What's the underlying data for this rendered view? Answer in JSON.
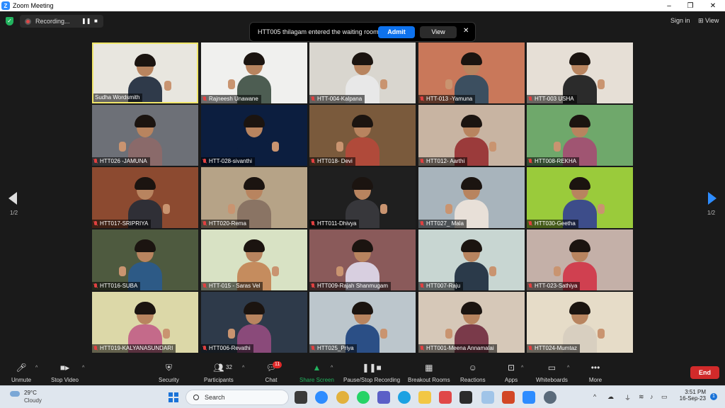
{
  "window": {
    "title": "Zoom Meeting",
    "controls": [
      "–",
      "❐",
      "✕"
    ]
  },
  "top": {
    "recording_label": "Recording...",
    "sign_in": "Sign in",
    "view": "View"
  },
  "waiting_room": {
    "message": "HTT005 thilagam entered the waiting room",
    "admit": "Admit",
    "view": "View",
    "close": "✕"
  },
  "pager": {
    "left": "1/2",
    "right": "1/2"
  },
  "participants": [
    {
      "name": "Sudha Wordsmith",
      "muted": false,
      "active": true,
      "bg": "#e8e6df",
      "shirt": "#2f3a4a"
    },
    {
      "name": "Rajneesh Unawane",
      "muted": true,
      "bg": "#f0f0ee",
      "shirt": "#4d5d52"
    },
    {
      "name": "HTT-004-Kalpana",
      "muted": true,
      "bg": "#d9d6cf",
      "shirt": "#e8e8e8"
    },
    {
      "name": "HTT-013 -Yamuna",
      "muted": true,
      "bg": "#c9785a",
      "shirt": "#3c4f60"
    },
    {
      "name": "HTT-003 USHA",
      "muted": true,
      "bg": "#e6dfd6",
      "shirt": "#2b2b2b"
    },
    {
      "name": "HTT026 -JAMUNA",
      "muted": true,
      "bg": "#6d7077",
      "shirt": "#8a6a6a"
    },
    {
      "name": "HTT-028-sivanthi",
      "muted": true,
      "bg": "#0c1e3f",
      "shirt": "#0c1e3f"
    },
    {
      "name": "HTT018- Devi",
      "muted": true,
      "bg": "#7a5a3c",
      "shirt": "#b04a3a"
    },
    {
      "name": "HTT012- Aarthi",
      "muted": true,
      "bg": "#c8b4a2",
      "shirt": "#9b3b3b"
    },
    {
      "name": "HTT008-REKHA",
      "muted": true,
      "bg": "#6fa86b",
      "shirt": "#a05572"
    },
    {
      "name": "HTT017-SRIPRIYA",
      "muted": true,
      "bg": "#8c4a30",
      "shirt": "#2f2f36"
    },
    {
      "name": "HTT020-Rema",
      "muted": true,
      "bg": "#b6a387",
      "shirt": "#8a7464"
    },
    {
      "name": "HTT011-Dhivya",
      "muted": true,
      "bg": "#1f1f1f",
      "shirt": "#37373b"
    },
    {
      "name": "HTT027_ Mala",
      "muted": true,
      "bg": "#a8b4bc",
      "shirt": "#e8e0d8"
    },
    {
      "name": "HTT030-Geetha",
      "muted": true,
      "bg": "#9acb3b",
      "shirt": "#3d4d8a"
    },
    {
      "name": "HTT016-SUBA",
      "muted": true,
      "bg": "#4e5a3f",
      "shirt": "#2d5a86"
    },
    {
      "name": "HTT-015 - Saras Vel",
      "muted": true,
      "bg": "#d8e2c4",
      "shirt": "#c58c5e"
    },
    {
      "name": "HTT009-Rajah Shanmugam",
      "muted": true,
      "bg": "#8a5a5a",
      "shirt": "#d8cfe0"
    },
    {
      "name": "HTT007-Raju",
      "muted": true,
      "bg": "#c8d6d2",
      "shirt": "#2b3a4a"
    },
    {
      "name": "HTT-023-Sathiya",
      "muted": true,
      "bg": "#c4b0a8",
      "shirt": "#d04050"
    },
    {
      "name": "HTT019-KALYANASUNDARI",
      "muted": true,
      "bg": "#dcd8a8",
      "shirt": "#c46a8a"
    },
    {
      "name": "HTT006-Revathi",
      "muted": true,
      "bg": "#2e3a4a",
      "shirt": "#8a4a7a"
    },
    {
      "name": "HTT025_Priya",
      "muted": true,
      "bg": "#bcc6cc",
      "shirt": "#2b4f86"
    },
    {
      "name": "HTT001-Meena Annamalai",
      "muted": true,
      "bg": "#d6c8b8",
      "shirt": "#7a3a4a"
    },
    {
      "name": "HTT024-Mumtaz",
      "muted": true,
      "bg": "#e6dcc8",
      "shirt": "#d8cfc0"
    }
  ],
  "toolbar": {
    "unmute": "Unmute",
    "stop_video": "Stop Video",
    "security": "Security",
    "participants": "Participants",
    "participants_count": "32",
    "chat": "Chat",
    "chat_badge": "11",
    "share_screen": "Share Screen",
    "pause_stop_recording": "Pause/Stop Recording",
    "breakout_rooms": "Breakout Rooms",
    "reactions": "Reactions",
    "apps": "Apps",
    "whiteboards": "Whiteboards",
    "more": "More",
    "end": "End",
    "share_color": "#22b35e"
  },
  "taskbar": {
    "temperature": "29°C",
    "weather": "Cloudy",
    "search": "Search",
    "time": "3:51 PM",
    "date": "16-Sep-23",
    "notification_count": "1"
  }
}
